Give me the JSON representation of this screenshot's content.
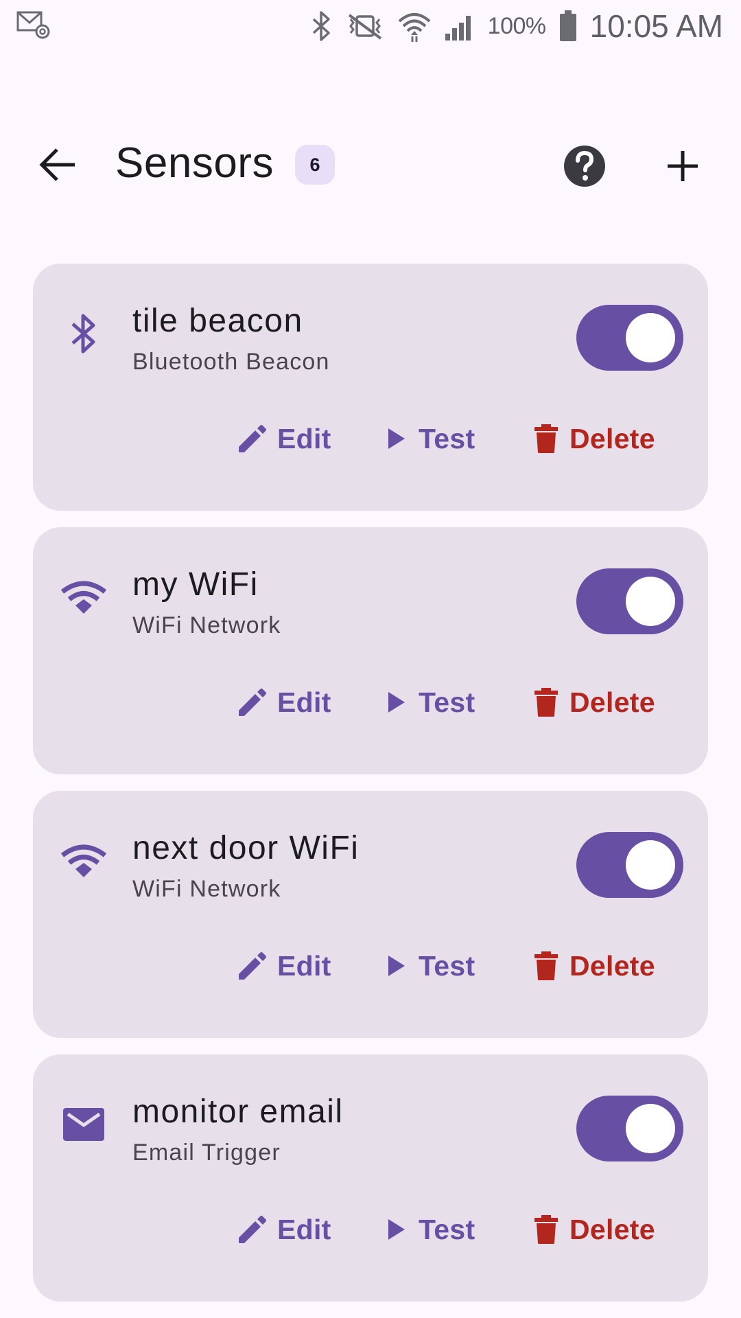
{
  "status_bar": {
    "battery": "100%",
    "time": "10:05 AM",
    "icons": [
      "email-notification-icon",
      "bluetooth-icon",
      "vibrate-mute-icon",
      "wifi-icon",
      "signal-icon",
      "battery-icon"
    ]
  },
  "app_bar": {
    "title": "Sensors",
    "count": "6",
    "icons": [
      "back-arrow-icon",
      "help-icon",
      "add-icon"
    ]
  },
  "colors": {
    "accent": "#6750a4",
    "danger": "#b3261e",
    "card": "#e7e0ea",
    "background": "#fdf7fe",
    "badge": "#e8def8"
  },
  "actions": {
    "edit": "Edit",
    "test": "Test",
    "delete": "Delete"
  },
  "sensors": [
    {
      "name": "tile beacon",
      "type": "Bluetooth Beacon",
      "icon": "bluetooth-icon",
      "enabled": true
    },
    {
      "name": "my WiFi",
      "type": "WiFi Network",
      "icon": "wifi-icon",
      "enabled": true
    },
    {
      "name": "next door WiFi",
      "type": "WiFi Network",
      "icon": "wifi-icon",
      "enabled": true
    },
    {
      "name": "monitor email",
      "type": "Email Trigger",
      "icon": "email-icon",
      "enabled": true
    }
  ]
}
